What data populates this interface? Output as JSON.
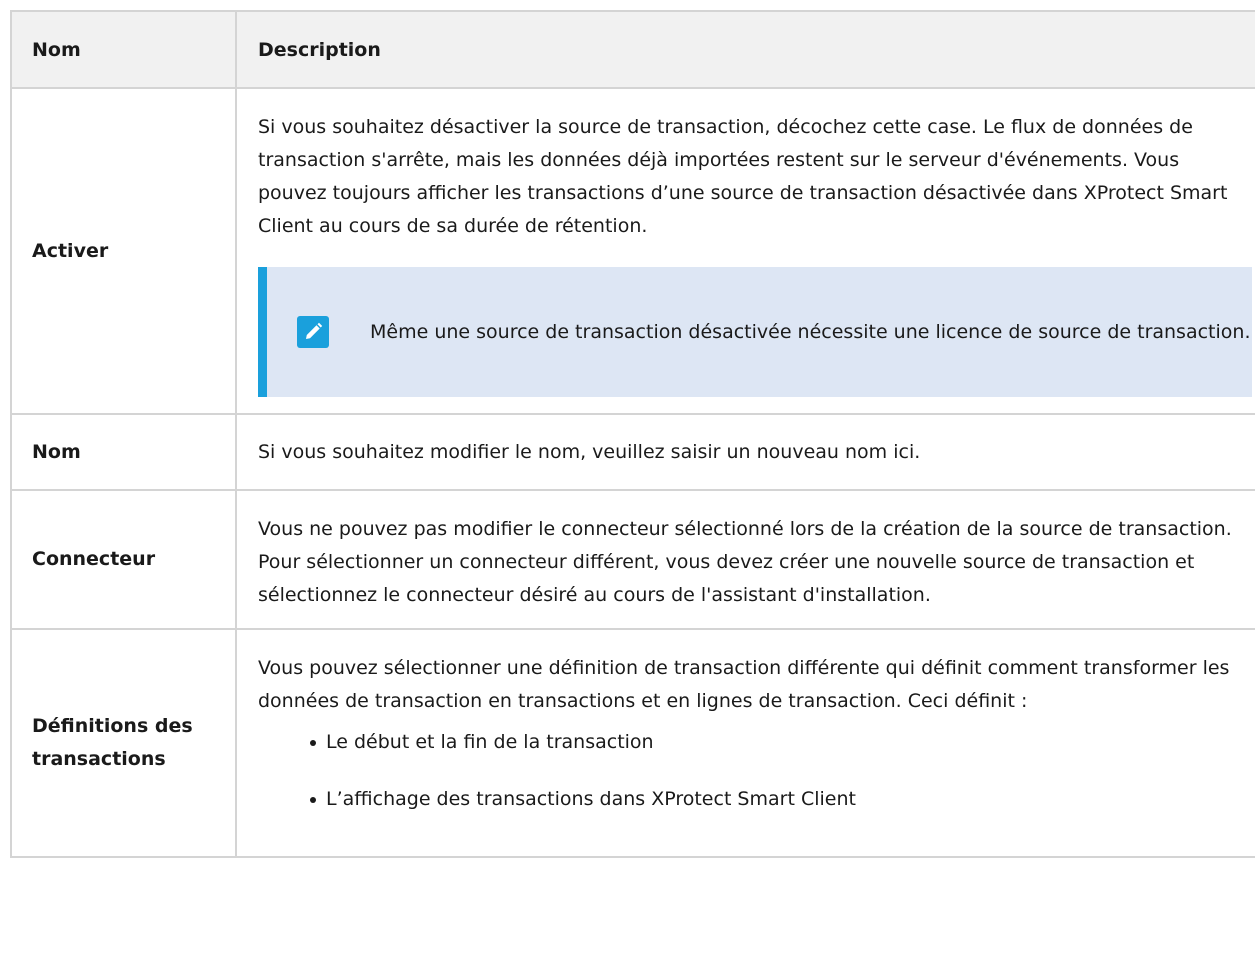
{
  "table": {
    "headers": {
      "name": "Nom",
      "description": "Description"
    },
    "rows": [
      {
        "name": "Activer",
        "description": "Si vous souhaitez désactiver la source de transaction, décochez cette case. Le flux de données de transaction s'arrête, mais les données déjà importées restent sur le serveur d'événements. Vous pouvez toujours afficher les transactions d’une source de transaction désactivée dans XProtect Smart Client au cours de sa durée de rétention.",
        "note": {
          "icon": "pencil-note-icon",
          "text": "Même une source de transaction désactivée nécessite une licence de source de transaction."
        }
      },
      {
        "name": "Nom",
        "description": "Si vous souhaitez modifier le nom, veuillez saisir un nouveau nom ici."
      },
      {
        "name": "Connecteur",
        "description": "Vous ne pouvez pas modifier le connecteur sélectionné lors de la création de la source de transaction. Pour sélectionner un connecteur différent, vous devez créer une nouvelle source de transaction et sélectionnez le connecteur désiré au cours de l'assistant d'installation."
      },
      {
        "name": "Définitions des transactions",
        "description": "Vous pouvez sélectionner une définition de transaction différente qui définit comment transformer les données de transaction en transactions et en lignes de transaction. Ceci définit :",
        "bullets": [
          "Le début et la fin de la transaction",
          "L’affichage des transactions dans XProtect Smart Client"
        ]
      }
    ]
  },
  "colors": {
    "note_background": "#dde6f4",
    "note_accent": "#1aa0dc",
    "header_background": "#f1f1f1",
    "border": "#d4d4d4"
  }
}
